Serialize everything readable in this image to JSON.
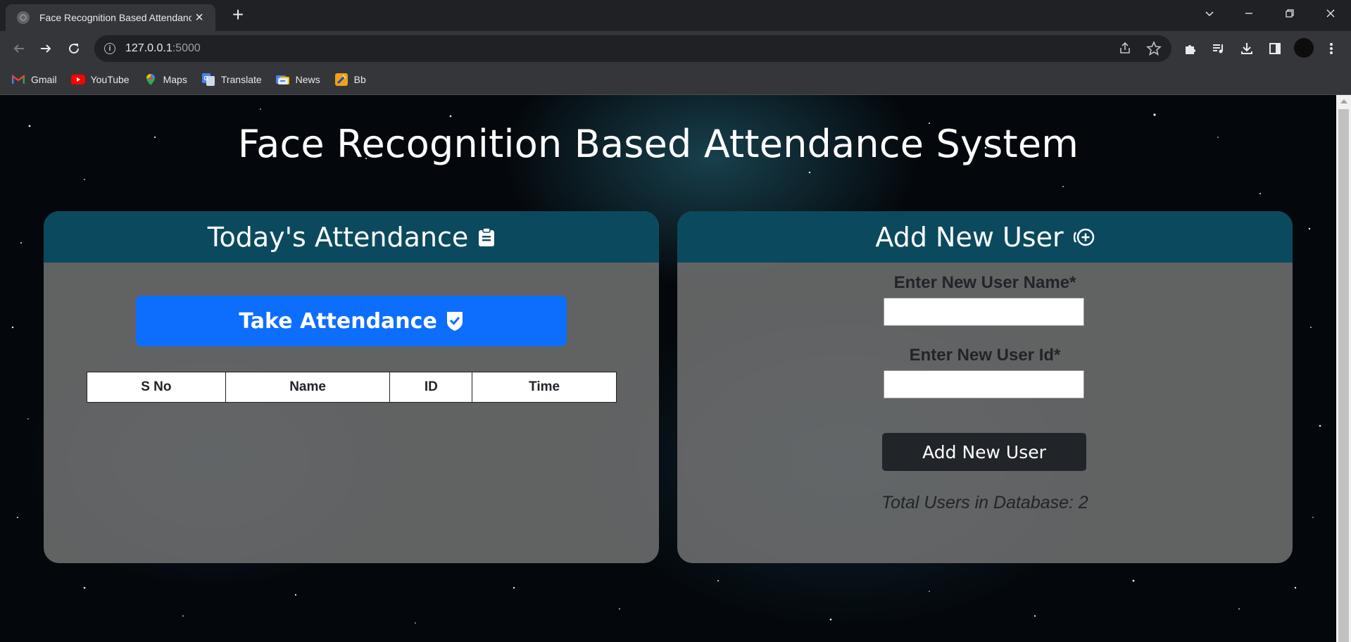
{
  "browser": {
    "tab_title": "Face Recognition Based Attendance System",
    "url_host": "127.0.0.1",
    "url_port": ":5000",
    "bookmarks": [
      {
        "label": "Gmail",
        "icon": "gmail-icon"
      },
      {
        "label": "YouTube",
        "icon": "youtube-icon"
      },
      {
        "label": "Maps",
        "icon": "maps-icon"
      },
      {
        "label": "Translate",
        "icon": "translate-icon"
      },
      {
        "label": "News",
        "icon": "news-icon"
      },
      {
        "label": "Bb",
        "icon": "bb-icon"
      }
    ]
  },
  "page": {
    "title": "Face Recognition Based Attendance System"
  },
  "attendance": {
    "header": "Today's Attendance",
    "take_button": "Take Attendance",
    "columns": [
      "S No",
      "Name",
      "ID",
      "Time"
    ],
    "rows": []
  },
  "add_user": {
    "header": "Add New User",
    "name_label": "Enter New User Name*",
    "name_value": "",
    "id_label": "Enter New User Id*",
    "id_value": "",
    "button": "Add New User",
    "total_users": "Total Users in Database: 2"
  },
  "colors": {
    "panel_header": "#0b4a5e",
    "take_button": "#0d6efd",
    "add_button": "#212529"
  }
}
